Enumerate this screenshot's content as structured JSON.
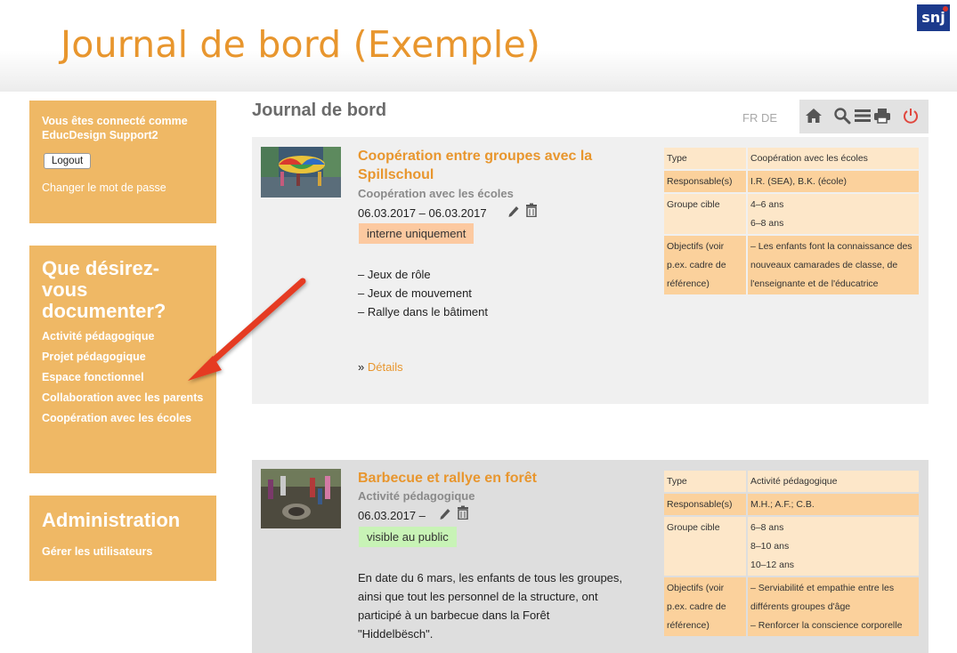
{
  "site": {
    "title": "Journal de bord (Exemple)",
    "logo_text": "snj"
  },
  "sidebar": {
    "user": {
      "connected_text": "Vous êtes connecté comme EducDesign Support2",
      "logout_label": "Logout",
      "change_password": "Changer le mot de passe"
    },
    "document": {
      "title": "Que désirez-vous documenter?",
      "items": [
        {
          "label": "Activité pédagogique"
        },
        {
          "label": "Projet pédagogique"
        },
        {
          "label": "Espace fonctionnel"
        },
        {
          "label": "Collaboration avec les parents"
        },
        {
          "label": "Coopération avec les écoles"
        }
      ]
    },
    "admin": {
      "title": "Administration",
      "items": [
        {
          "label": "Gérer les utilisateurs"
        }
      ]
    }
  },
  "main": {
    "title": "Journal de bord",
    "languages": [
      "FR",
      "DE"
    ],
    "toolbar_icons": [
      "home-icon",
      "search-icon",
      "list-icon",
      "print-icon",
      "power-icon"
    ],
    "entries": [
      {
        "title": "Coopération entre groupes avec la Spillschoul",
        "subtitle": "Coopération avec les écoles",
        "date": "06.03.2017 – 06.03.2017",
        "visibility": "interne uniquement",
        "bullets": [
          "– Jeux de rôle",
          "– Jeux de mouvement",
          "– Rallye dans le bâtiment"
        ],
        "details_prefix": "»",
        "details_label": "Détails",
        "info": {
          "type_label": "Type",
          "type_value": "Coopération avec les écoles",
          "resp_label": "Responsable(s)",
          "resp_value": "I.R. (SEA), B.K. (école)",
          "target_label": "Groupe cible",
          "target_values": [
            "4–6 ans",
            "6–8 ans"
          ],
          "obj_label": "Objectifs (voir p.ex. cadre de référence)",
          "obj_value": "– Les enfants font la connaissance des nouveaux camarades de classe, de l'enseignante et de l'éducatrice"
        }
      },
      {
        "title": "Barbecue et rallye en forêt",
        "subtitle": "Activité pédagogique",
        "date": "06.03.2017 –",
        "visibility": "visible au public",
        "description": "En date du 6 mars, les enfants de tous les groupes, ainsi que tout les personnel de la structure, ont participé à un barbecue dans la Forêt \"Hiddelbësch\".",
        "info": {
          "type_label": "Type",
          "type_value": "Activité pédagogique",
          "resp_label": "Responsable(s)",
          "resp_value": "M.H.; A.F.; C.B.",
          "target_label": "Groupe cible",
          "target_values": [
            "6–8 ans",
            "8–10 ans",
            "10–12 ans"
          ],
          "obj_label": "Objectifs (voir p.ex. cadre de référence)",
          "obj_values": [
            "– Serviabilité et empathie entre les différents groupes d'âge",
            "– Renforcer la conscience corporelle"
          ]
        }
      }
    ]
  },
  "colors": {
    "accent": "#e8962e",
    "sidebar": "#efb865",
    "badge_internal": "#fcc9a0",
    "badge_public": "#c8f3b6",
    "arrow": "#e53a24"
  }
}
